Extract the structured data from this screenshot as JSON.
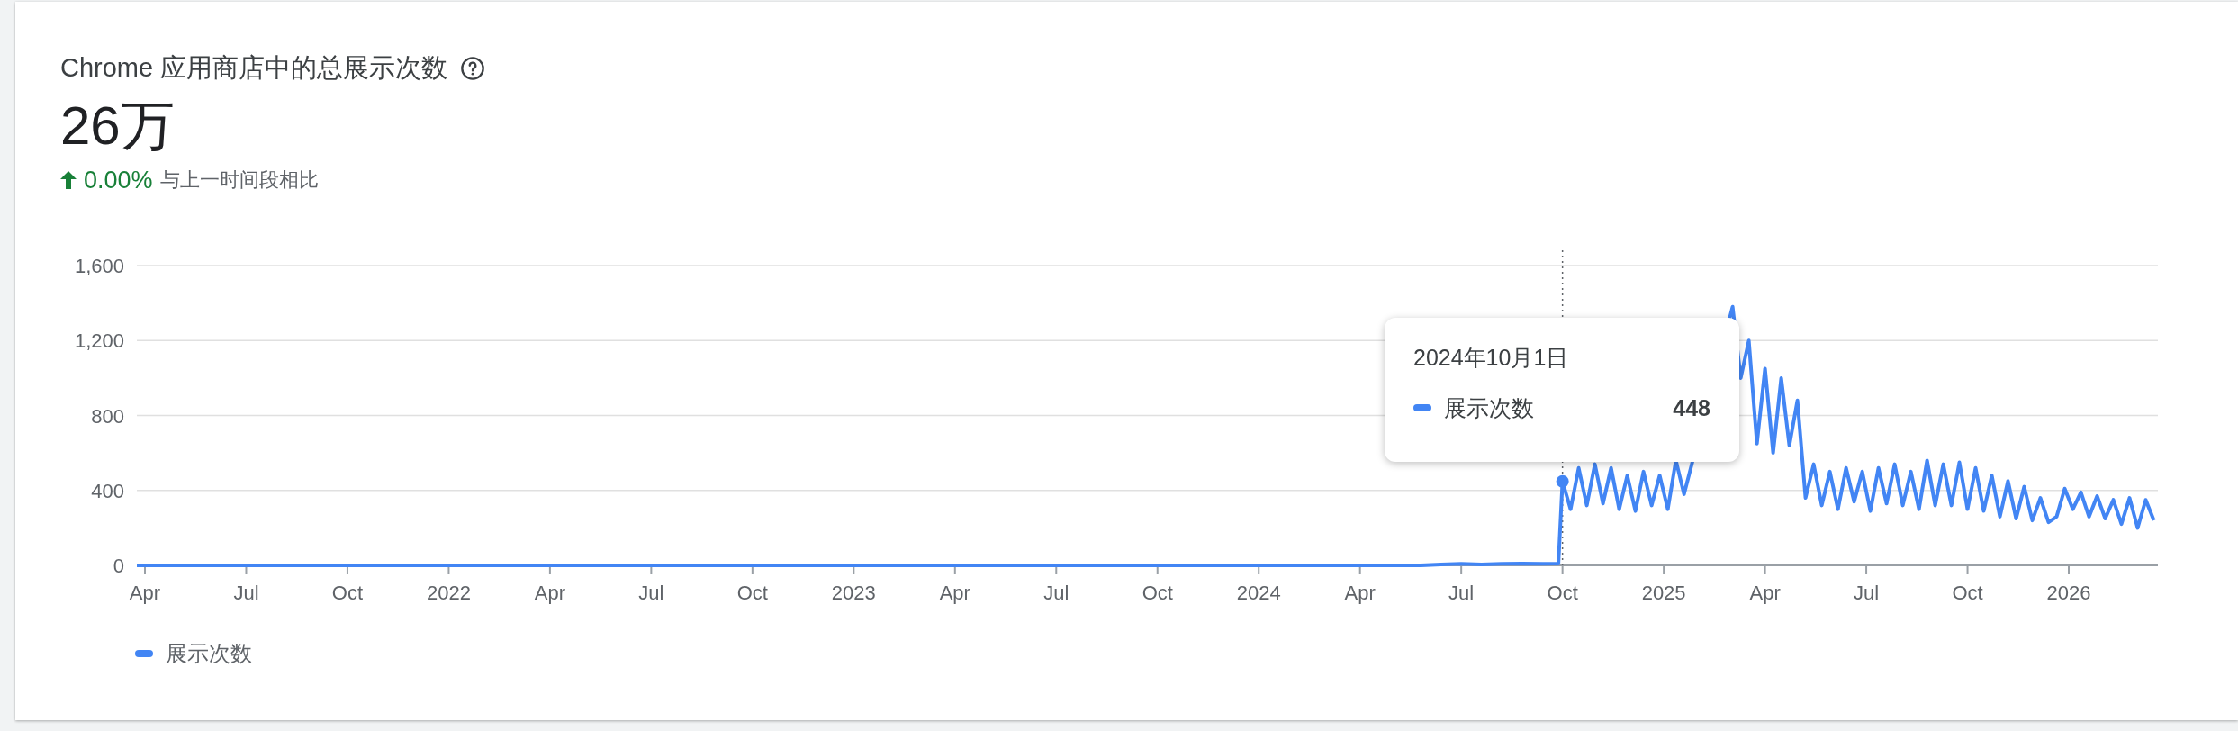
{
  "card": {
    "title": "Chrome 应用商店中的总展示次数",
    "total": "26万",
    "change": {
      "increase": true,
      "value": "0.00%",
      "note": "与上一时间段相比"
    },
    "chart_data": {
      "type": "line",
      "grid": true,
      "x": [
        2021.23,
        2024.4,
        2024.45,
        2024.5,
        2024.55,
        2024.6,
        2024.65,
        2024.7,
        2024.74,
        2024.75,
        2024.77,
        2024.79,
        2024.81,
        2024.83,
        2024.85,
        2024.87,
        2024.89,
        2024.91,
        2024.93,
        2024.95,
        2024.97,
        2024.99,
        2025.01,
        2025.03,
        2025.05,
        2025.17,
        2025.19,
        2025.21,
        2025.23,
        2025.25,
        2025.27,
        2025.29,
        2025.31,
        2025.33,
        2025.35,
        2025.37,
        2025.39,
        2025.41,
        2025.43,
        2025.45,
        2025.47,
        2025.49,
        2025.51,
        2025.53,
        2025.55,
        2025.57,
        2025.59,
        2025.61,
        2025.63,
        2025.65,
        2025.67,
        2025.69,
        2025.71,
        2025.73,
        2025.75,
        2025.77,
        2025.79,
        2025.81,
        2025.83,
        2025.85,
        2025.87,
        2025.89,
        2025.91,
        2025.93,
        2025.95,
        2025.97,
        2025.99,
        2026.01,
        2026.03,
        2026.05,
        2026.07,
        2026.09,
        2026.11,
        2026.13,
        2026.15,
        2026.17,
        2026.19,
        2026.21
      ],
      "series": [
        {
          "name": "展示次数",
          "color": "#4285f4",
          "values": [
            0,
            0,
            5,
            8,
            5,
            8,
            10,
            8,
            10,
            448,
            300,
            520,
            320,
            540,
            330,
            520,
            300,
            480,
            290,
            500,
            320,
            480,
            300,
            560,
            380,
            1380,
            1000,
            1200,
            650,
            1050,
            600,
            1000,
            640,
            880,
            360,
            540,
            320,
            500,
            300,
            520,
            340,
            500,
            290,
            520,
            330,
            540,
            320,
            500,
            300,
            560,
            320,
            540,
            320,
            550,
            300,
            520,
            290,
            480,
            260,
            450,
            250,
            420,
            240,
            360,
            230,
            260,
            410,
            300,
            390,
            260,
            370,
            250,
            350,
            220,
            360,
            200,
            350,
            240
          ]
        }
      ],
      "xlim": [
        2021.23,
        2026.22
      ],
      "ylim": [
        0,
        1600
      ],
      "yticks": [
        {
          "value": 0,
          "label": "0"
        },
        {
          "value": 400,
          "label": "400"
        },
        {
          "value": 800,
          "label": "800"
        },
        {
          "value": 1200,
          "label": "1,200"
        },
        {
          "value": 1600,
          "label": "1,600"
        }
      ],
      "xticks": [
        {
          "value": 2021.25,
          "label": "Apr"
        },
        {
          "value": 2021.5,
          "label": "Jul"
        },
        {
          "value": 2021.75,
          "label": "Oct"
        },
        {
          "value": 2022,
          "label": "2022"
        },
        {
          "value": 2022.25,
          "label": "Apr"
        },
        {
          "value": 2022.5,
          "label": "Jul"
        },
        {
          "value": 2022.75,
          "label": "Oct"
        },
        {
          "value": 2023,
          "label": "2023"
        },
        {
          "value": 2023.25,
          "label": "Apr"
        },
        {
          "value": 2023.5,
          "label": "Jul"
        },
        {
          "value": 2023.75,
          "label": "Oct"
        },
        {
          "value": 2024,
          "label": "2024"
        },
        {
          "value": 2024.25,
          "label": "Apr"
        },
        {
          "value": 2024.5,
          "label": "Jul"
        },
        {
          "value": 2024.75,
          "label": "Oct"
        },
        {
          "value": 2025,
          "label": "2025"
        },
        {
          "value": 2025.25,
          "label": "Apr"
        },
        {
          "value": 2025.5,
          "label": "Jul"
        },
        {
          "value": 2025.75,
          "label": "Oct"
        },
        {
          "value": 2026,
          "label": "2026"
        }
      ],
      "ref_lines": [
        {
          "axis": "x",
          "value": 2024.75
        }
      ]
    },
    "tooltip": {
      "date": "2024年10月1日",
      "series_name": "展示次数",
      "value": "448",
      "color": "#4285f4"
    }
  }
}
